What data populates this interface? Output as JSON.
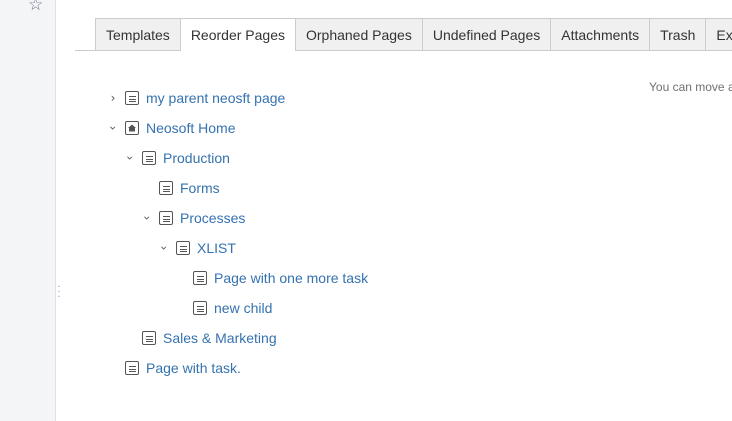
{
  "sidebar": {
    "star_icon": "star-icon",
    "resize_handle": "drag-handle-icon"
  },
  "tabs": [
    {
      "label": "Templates"
    },
    {
      "label": "Reorder Pages",
      "active": true
    },
    {
      "label": "Orphaned Pages"
    },
    {
      "label": "Undefined Pages"
    },
    {
      "label": "Attachments"
    },
    {
      "label": "Trash"
    },
    {
      "label": "Ex"
    }
  ],
  "hint": "You can move a",
  "tree": [
    {
      "label": "my parent neosft page",
      "state": "collapsed",
      "icon": "page-icon"
    },
    {
      "label": "Neosoft Home",
      "state": "expanded",
      "icon": "home-page-icon"
    },
    {
      "label": "Production",
      "state": "expanded",
      "icon": "page-icon"
    },
    {
      "label": "Forms",
      "state": "leaf",
      "icon": "page-icon"
    },
    {
      "label": "Processes",
      "state": "expanded",
      "icon": "page-icon"
    },
    {
      "label": "XLIST",
      "state": "expanded",
      "icon": "page-icon"
    },
    {
      "label": "Page with one more task",
      "state": "leaf",
      "icon": "page-icon"
    },
    {
      "label": "new child",
      "state": "leaf",
      "icon": "page-icon"
    },
    {
      "label": "Sales & Marketing",
      "state": "leaf",
      "icon": "page-icon"
    },
    {
      "label": "Page with task.",
      "state": "leaf",
      "icon": "page-icon"
    }
  ],
  "colors": {
    "link": "#3572b0",
    "tab_bg": "#f0f0f0",
    "sidebar_bg": "#f4f5f7"
  }
}
